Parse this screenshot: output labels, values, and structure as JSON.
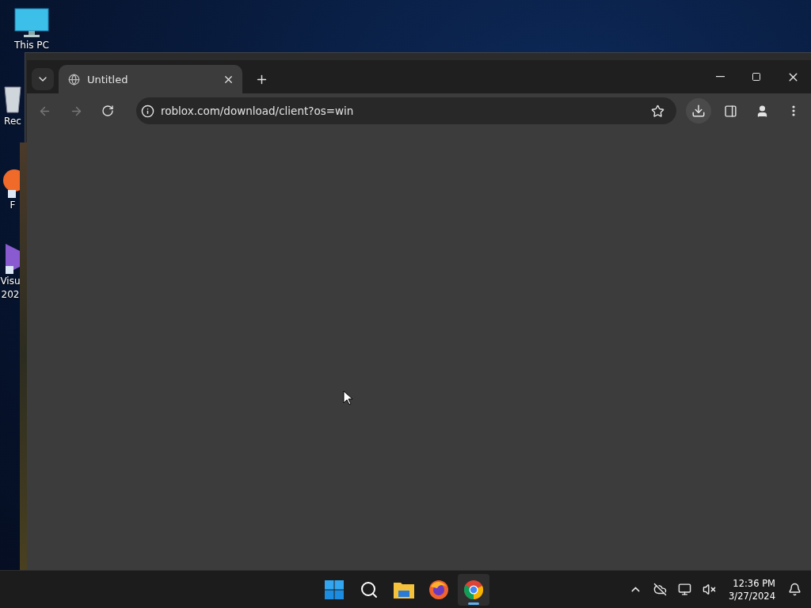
{
  "desktop_icons": [
    {
      "kind": "monitor",
      "lines": [
        "This PC"
      ]
    },
    {
      "kind": "recycle",
      "lines": [
        "Rec"
      ]
    },
    {
      "kind": "orange-app",
      "lines": [
        "F"
      ]
    },
    {
      "kind": "purple-app",
      "lines": [
        "Visu",
        "202"
      ]
    }
  ],
  "browser": {
    "tabs": [
      {
        "title": "Untitled",
        "selected": true
      }
    ],
    "back_disabled": true,
    "forward_disabled": true,
    "address": "roblox.com/download/client?os=win",
    "download_active": true
  },
  "taskbar": {
    "apps": [
      {
        "kind": "start",
        "selected": false
      },
      {
        "kind": "search",
        "selected": false
      },
      {
        "kind": "files",
        "selected": false
      },
      {
        "kind": "firefox",
        "selected": false
      },
      {
        "kind": "chrome",
        "selected": true
      }
    ],
    "time": "12:36 PM",
    "date": "3/27/2024"
  }
}
